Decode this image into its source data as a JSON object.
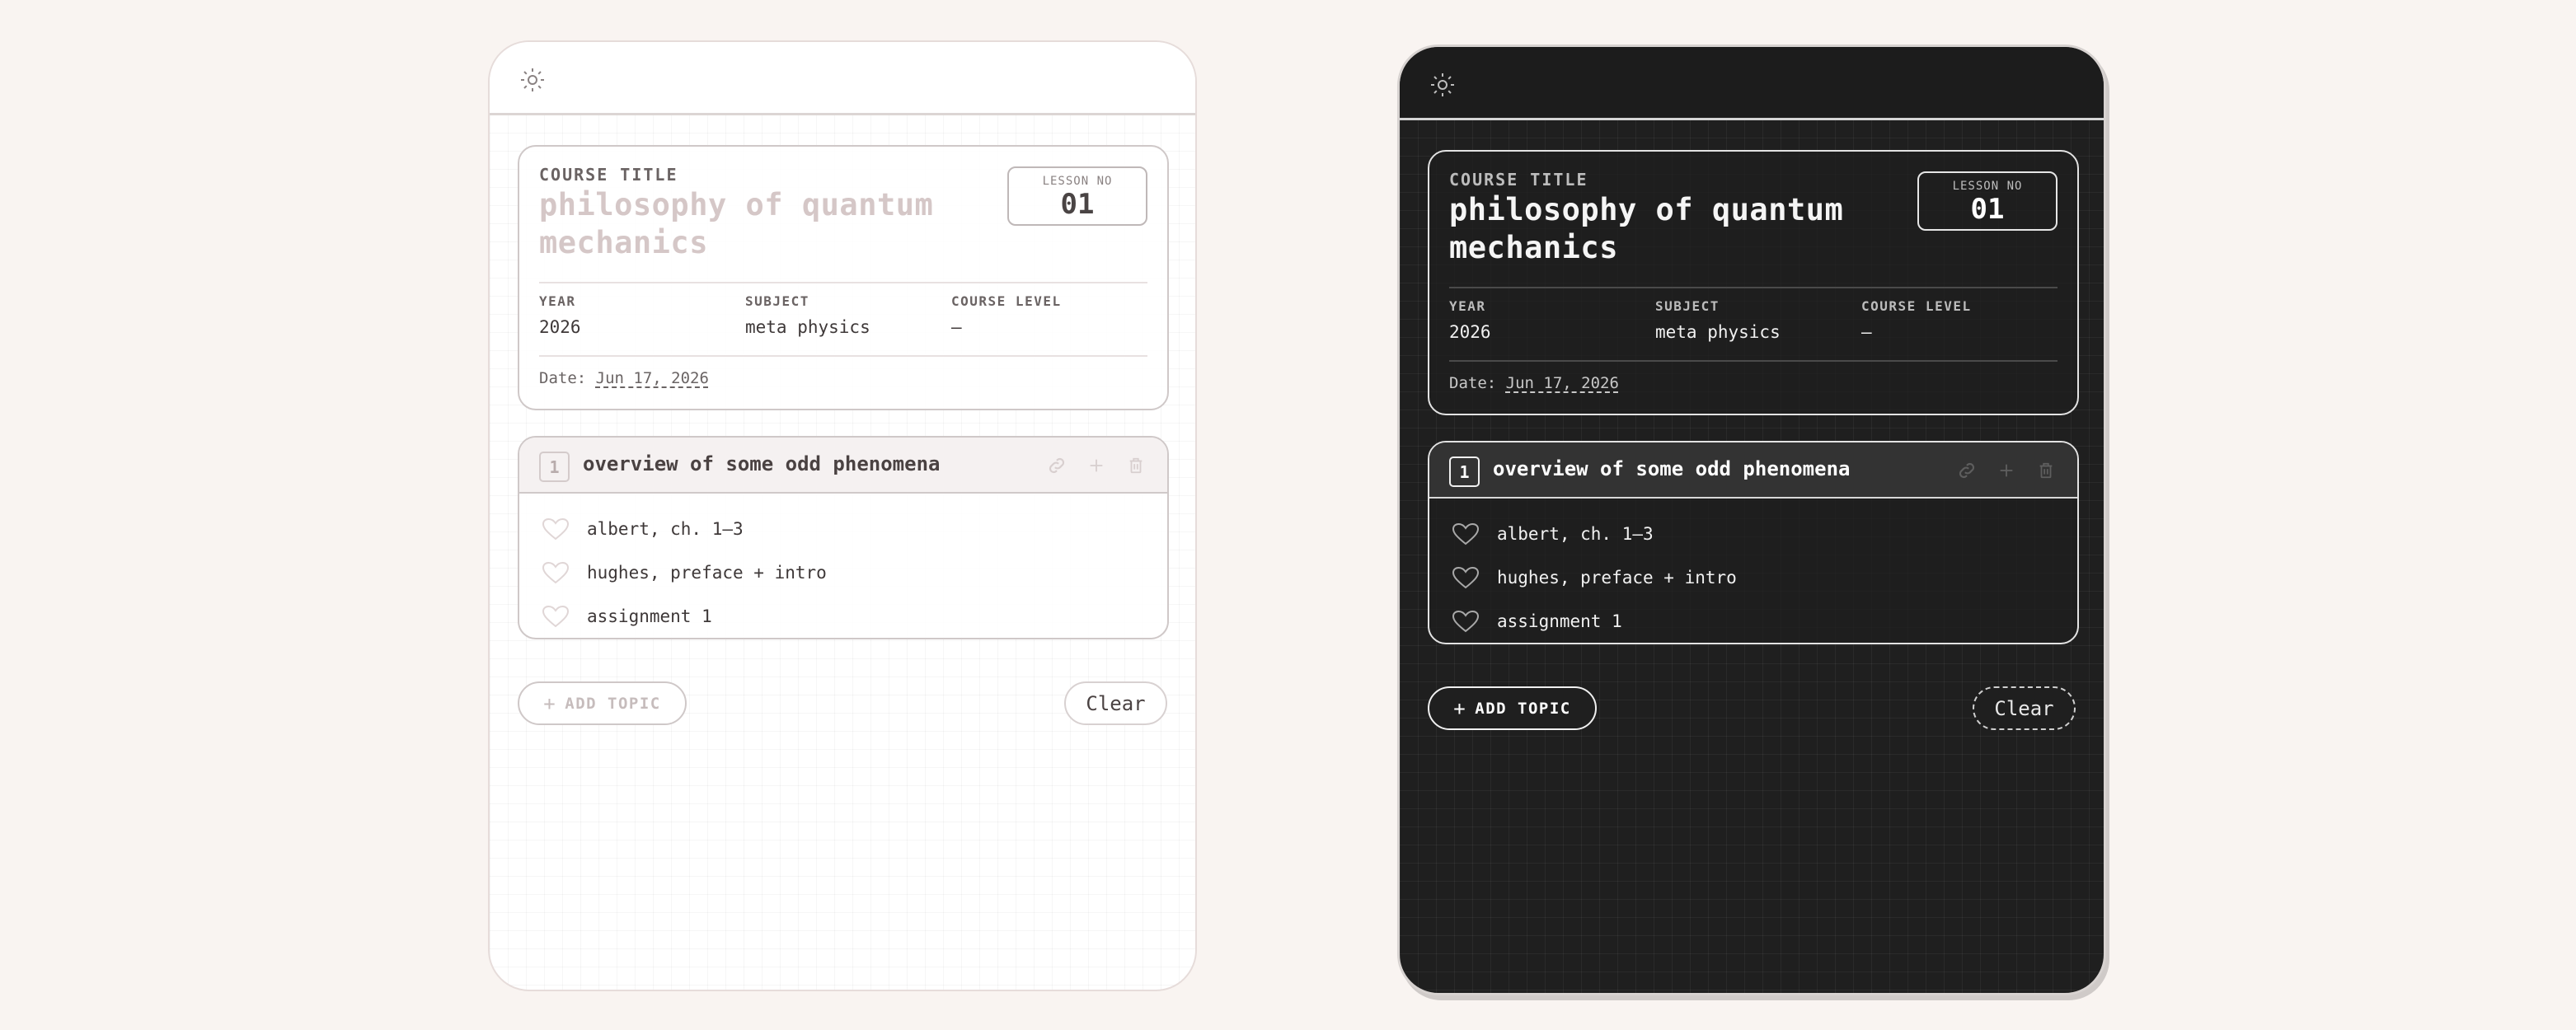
{
  "panels": [
    {
      "theme": "light",
      "theme_toggle_icon": "sun-icon",
      "course_label": "COURSE TITLE",
      "course_title": "philosophy of quantum mechanics",
      "lesson_label": "LESSON NO",
      "lesson_value": "01",
      "year_label": "YEAR",
      "year_value": "2026",
      "subject_label": "SUBJECT",
      "subject_value": "meta physics",
      "level_label": "COURSE LEVEL",
      "level_value": "–",
      "date_label": "Date:",
      "date_value": "Jun 17, 2026",
      "topic": {
        "number": "1",
        "title": "overview of some odd phenomena",
        "actions": [
          "link-icon",
          "plus-icon",
          "trash-icon"
        ],
        "items": [
          "albert, ch. 1–3",
          "hughes, preface + intro",
          "assignment 1"
        ]
      },
      "add_topic_label": "ADD TOPIC",
      "clear_label": "Clear"
    },
    {
      "theme": "dark",
      "theme_toggle_icon": "sun-icon",
      "course_label": "COURSE TITLE",
      "course_title": "philosophy of quantum mechanics",
      "lesson_label": "LESSON NO",
      "lesson_value": "01",
      "year_label": "YEAR",
      "year_value": "2026",
      "subject_label": "SUBJECT",
      "subject_value": "meta physics",
      "level_label": "COURSE LEVEL",
      "level_value": "–",
      "date_label": "Date:",
      "date_value": "Jun 17, 2026",
      "topic": {
        "number": "1",
        "title": "overview of some odd phenomena",
        "actions": [
          "link-icon",
          "plus-icon",
          "trash-icon"
        ],
        "items": [
          "albert, ch. 1–3",
          "hughes, preface + intro",
          "assignment 1"
        ]
      },
      "add_topic_label": "ADD TOPIC",
      "clear_label": "Clear"
    }
  ],
  "colors": {
    "page_background": "#f9f4f1",
    "light_panel": "#ffffff",
    "dark_panel": "#1f1f1f",
    "light_title_muted": "#d5c7c7"
  }
}
